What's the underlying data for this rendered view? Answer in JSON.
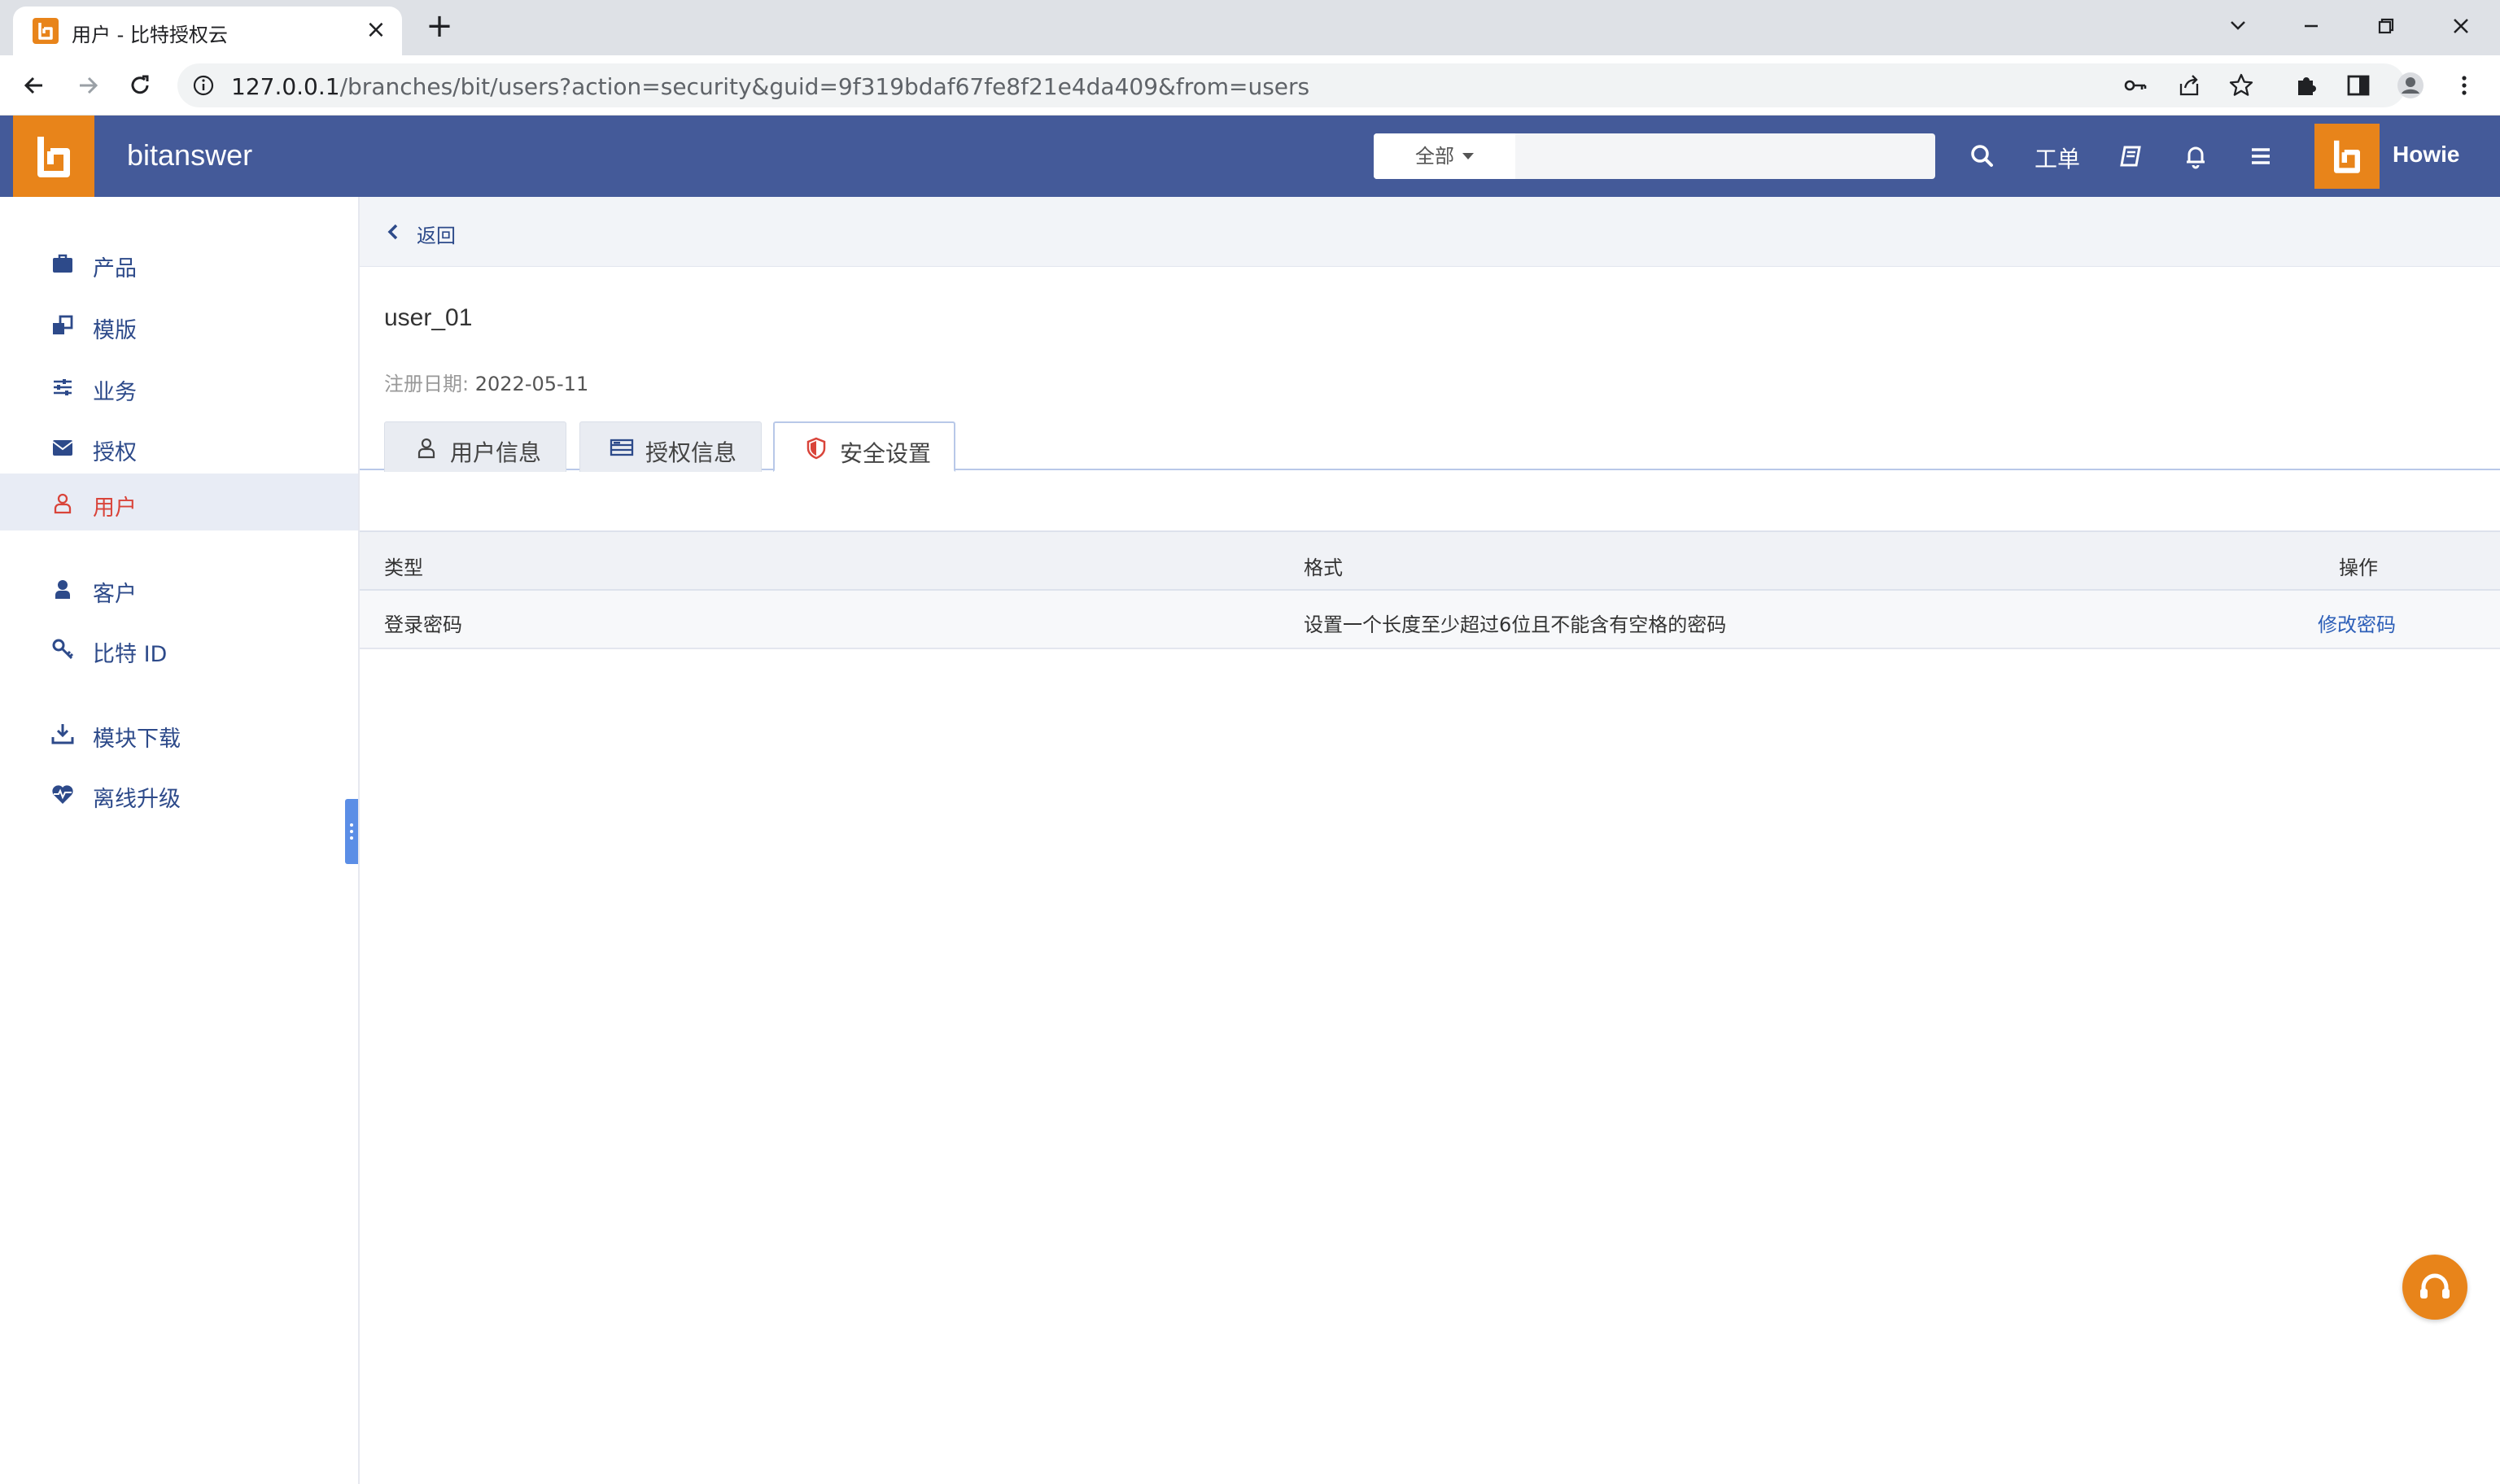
{
  "browser": {
    "tab_title": "用户 - 比特授权云",
    "url_host": "127.0.0.1",
    "url_path": "/branches/bit/users?action=security&guid=9f319bdaf67fe8f21e4da409&from=users"
  },
  "header": {
    "brand": "bitanswer",
    "search_scope": "全部",
    "search_placeholder": "",
    "workorder_label": "工单",
    "username": "Howie"
  },
  "sidebar": {
    "items": [
      {
        "label": "产品",
        "icon": "briefcase-icon"
      },
      {
        "label": "模版",
        "icon": "clone-icon"
      },
      {
        "label": "业务",
        "icon": "sliders-icon"
      },
      {
        "label": "授权",
        "icon": "envelope-icon"
      },
      {
        "label": "用户",
        "icon": "user-outline-icon",
        "active": true
      },
      {
        "label": "客户",
        "icon": "user-icon"
      },
      {
        "label": "比特 ID",
        "icon": "key-icon"
      },
      {
        "label": "模块下载",
        "icon": "download-icon"
      },
      {
        "label": "离线升级",
        "icon": "heartbeat-icon"
      }
    ]
  },
  "main": {
    "back_label": "返回",
    "user_name": "user_01",
    "reg_date_label": "注册日期:",
    "reg_date_value": "2022-05-11",
    "tabs": [
      {
        "label": "用户信息",
        "icon": "user-outline-icon"
      },
      {
        "label": "授权信息",
        "icon": "list-icon"
      },
      {
        "label": "安全设置",
        "icon": "shield-icon",
        "active": true
      }
    ],
    "table": {
      "headers": [
        "类型",
        "格式",
        "操作"
      ],
      "rows": [
        {
          "type": "登录密码",
          "format": "设置一个长度至少超过6位且不能含有空格的密码",
          "action": "修改密码"
        }
      ]
    }
  },
  "colors": {
    "header_bg": "#445a99",
    "brand_orange": "#e8841a",
    "nav_text": "#2d4a8a",
    "active_red": "#d9443a"
  }
}
